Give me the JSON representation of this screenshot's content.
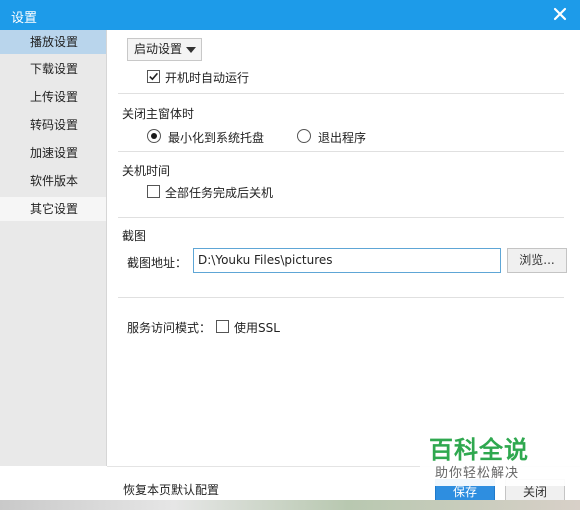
{
  "window": {
    "title": "设置",
    "close_icon": "close-icon"
  },
  "sidebar": {
    "items": [
      {
        "label": "播放设置"
      },
      {
        "label": "下载设置"
      },
      {
        "label": "上传设置"
      },
      {
        "label": "转码设置"
      },
      {
        "label": "加速设置"
      },
      {
        "label": "软件版本"
      },
      {
        "label": "其它设置"
      }
    ]
  },
  "startup": {
    "dropdown_value": "启动设置",
    "autorun_label": "开机时自动运行",
    "autorun_checked": true
  },
  "close_main": {
    "heading": "关闭主窗体时",
    "option_minimize": "最小化到系统托盘",
    "option_exit": "退出程序",
    "selected": "最小化到系统托盘"
  },
  "shutdown": {
    "heading": "关机时间",
    "label": "全部任务完成后关机",
    "checked": false
  },
  "screenshot": {
    "heading": "截图",
    "path_label": "截图地址：",
    "path_value": "D:\\Youku Files\\pictures",
    "browse_label": "浏览..."
  },
  "service": {
    "mode_label": "服务访问模式：",
    "ssl_label": "使用SSL",
    "ssl_checked": false
  },
  "footer": {
    "restore_label": "恢复本页默认配置",
    "save_label": "保存",
    "close_label": "关闭"
  },
  "watermark": {
    "title": "百科全说",
    "subtitle": "助你轻松解决"
  },
  "colors": {
    "titlebar": "#1d9be9",
    "sidebar_active": "#b9d5ec",
    "save_button": "#2e8ee0",
    "watermark": "#2fa84f"
  }
}
